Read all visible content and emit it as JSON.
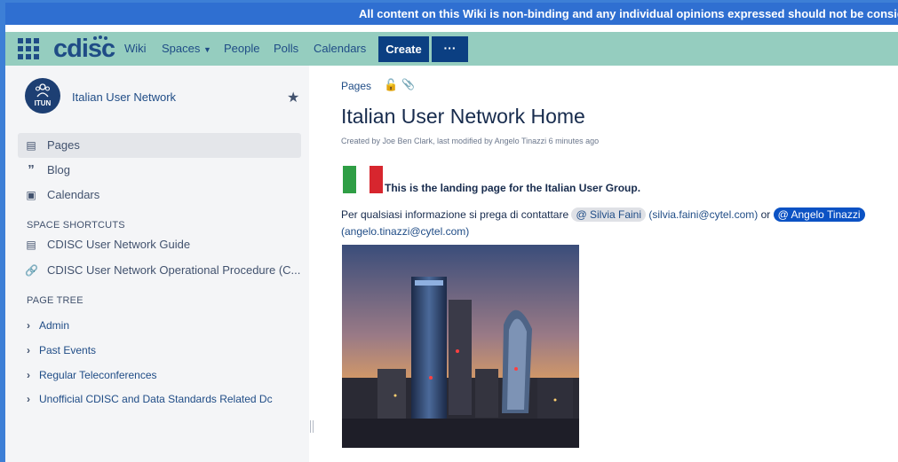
{
  "banner": {
    "text": "All content on this Wiki is non-binding and any individual opinions expressed should not be conside"
  },
  "nav": {
    "logo": "cdisc",
    "items": [
      "Wiki",
      "Spaces",
      "People",
      "Polls",
      "Calendars"
    ],
    "create_label": "Create",
    "more_label": "···"
  },
  "sidebar": {
    "space_name": "Italian User Network",
    "avatar_abbr": "ITUN",
    "links": [
      {
        "label": "Pages"
      },
      {
        "label": "Blog"
      },
      {
        "label": "Calendars"
      }
    ],
    "shortcuts_heading": "SPACE SHORTCUTS",
    "shortcuts": [
      {
        "label": "CDISC User Network Guide"
      },
      {
        "label": "CDISC User Network Operational Procedure (C..."
      }
    ],
    "tree_heading": "PAGE TREE",
    "tree": [
      {
        "label": "Admin"
      },
      {
        "label": "Past Events"
      },
      {
        "label": "Regular Teleconferences"
      },
      {
        "label": "Unofficial CDISC and Data Standards Related Dc"
      }
    ]
  },
  "main": {
    "breadcrumb": "Pages",
    "title": "Italian User Network Home",
    "meta": "Created by Joe Ben Clark, last modified by Angelo Tinazzi 6 minutes ago",
    "landing_text": "This is the landing page for the Italian User Group.",
    "contact_intro": "Per qualsiasi informazione si prega di contattare",
    "mention1": "@ Silvia Faini",
    "email1": "(silvia.faini@cytel.com)",
    "or_text": "or",
    "mention2": "@ Angelo Tinazzi",
    "email2": "(angelo.tinazzi@cytel.com)"
  },
  "colors": {
    "banner": "#2f6fd1",
    "navbar": "#95cdbf",
    "brand": "#1f4c86",
    "button": "#0b3f82",
    "flag_green": "#2f9e45",
    "flag_red": "#d7262e"
  },
  "icons": [
    "apps-grid-icon",
    "star-icon",
    "page-icon",
    "quote-icon",
    "calendar-icon",
    "link-icon",
    "chevron-right-icon",
    "unlock-icon",
    "attachment-icon"
  ]
}
